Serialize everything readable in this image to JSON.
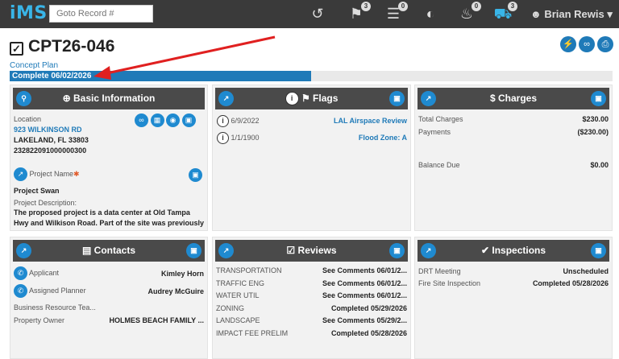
{
  "brand": {
    "logo": "iMS"
  },
  "search": {
    "placeholder": "Goto Record #"
  },
  "nav": {
    "history_icon": "history-icon",
    "bookmarks_badge": "3",
    "tasks_badge": "0",
    "notifications_badge": "0",
    "cart_badge": "3",
    "user_name": "Brian Rewis"
  },
  "record": {
    "number": "CPT26-046",
    "type": "Concept Plan",
    "status": "Complete 06/02/2026",
    "progress_fraction": 0.5
  },
  "basic_info": {
    "title": "Basic Information",
    "location_label": "Location",
    "address": "923 WILKINSON RD",
    "city": "LAKELAND, FL 33803",
    "parcel": "232822091000000300",
    "project_name_label": "Project Name",
    "project_name": "Project Swan",
    "description_label": "Project Description:",
    "description": "The proposed project is a data center at Old Tampa Hwy and Wilkison Road. Part of the site was previously"
  },
  "flags": {
    "title": "Flags",
    "items": [
      {
        "date": "6/9/2022",
        "label": "LAL Airspace Review"
      },
      {
        "date": "1/1/1900",
        "label": "Flood Zone: A"
      }
    ]
  },
  "charges": {
    "title": "$ Charges",
    "total_label": "Total Charges",
    "total": "$230.00",
    "payments_label": "Payments",
    "payments": "($230.00)",
    "balance_label": "Balance Due",
    "balance": "$0.00"
  },
  "contacts": {
    "title": "Contacts",
    "items": [
      {
        "role": "Applicant",
        "name": "Kimley Horn"
      },
      {
        "role": "Assigned Planner",
        "name": "Audrey McGuire"
      },
      {
        "role": "Business Resource Tea...",
        "name": ""
      },
      {
        "role": "Property Owner",
        "name": "HOLMES BEACH FAMILY ..."
      }
    ]
  },
  "reviews": {
    "title": "Reviews",
    "items": [
      {
        "name": "TRANSPORTATION",
        "status": "See Comments 06/01/2..."
      },
      {
        "name": "TRAFFIC ENG",
        "status": "See Comments 06/01/2..."
      },
      {
        "name": "WATER UTIL",
        "status": "See Comments 06/01/2..."
      },
      {
        "name": "ZONING",
        "status": "Completed 05/29/2026"
      },
      {
        "name": "LANDSCAPE",
        "status": "See Comments 05/29/2..."
      },
      {
        "name": "IMPACT FEE PRELIM",
        "status": "Completed 05/28/2026"
      }
    ]
  },
  "inspections": {
    "title": "Inspections",
    "items": [
      {
        "name": "DRT Meeting",
        "status": "Unscheduled"
      },
      {
        "name": "Fire Site Inspection",
        "status": "Completed 05/28/2026"
      }
    ]
  },
  "colors": {
    "accent": "#1f7ab8",
    "topbar": "#3a3a3a",
    "arrow": "#e02020"
  }
}
